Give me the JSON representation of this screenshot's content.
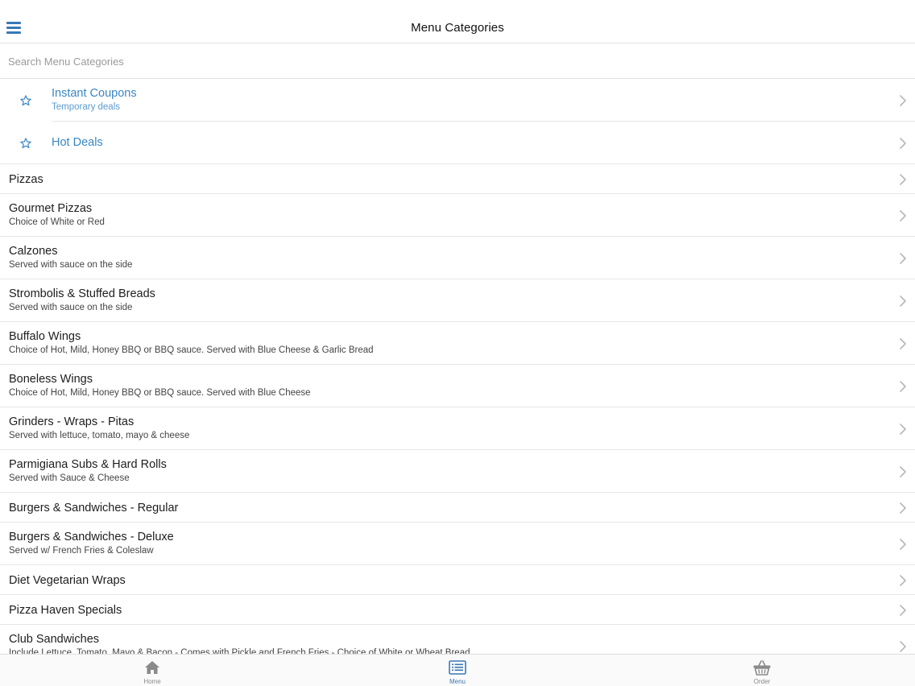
{
  "header": {
    "title": "Menu Categories",
    "menu_icon": "hamburger-icon"
  },
  "search": {
    "placeholder": "Search Menu Categories",
    "value": ""
  },
  "favorites": [
    {
      "title": "Instant Coupons",
      "subtitle": "Temporary deals",
      "icon": "star-outline-icon"
    },
    {
      "title": "Hot Deals",
      "subtitle": "",
      "icon": "star-outline-icon"
    }
  ],
  "categories": [
    {
      "title": "Pizzas",
      "subtitle": ""
    },
    {
      "title": "Gourmet Pizzas",
      "subtitle": "Choice of White or Red"
    },
    {
      "title": "Calzones",
      "subtitle": "Served with sauce on the side"
    },
    {
      "title": "Strombolis & Stuffed Breads",
      "subtitle": "Served with sauce on the side"
    },
    {
      "title": "Buffalo Wings",
      "subtitle": "Choice of Hot, Mild, Honey BBQ or BBQ sauce. Served with Blue Cheese & Garlic Bread"
    },
    {
      "title": "Boneless Wings",
      "subtitle": "Choice of Hot, Mild, Honey BBQ or BBQ sauce. Served with Blue Cheese"
    },
    {
      "title": "Grinders - Wraps - Pitas",
      "subtitle": "Served with lettuce, tomato, mayo & cheese"
    },
    {
      "title": "Parmigiana Subs & Hard Rolls",
      "subtitle": "Served with Sauce & Cheese"
    },
    {
      "title": "Burgers & Sandwiches - Regular",
      "subtitle": ""
    },
    {
      "title": "Burgers & Sandwiches - Deluxe",
      "subtitle": "Served w/ French Fries & Coleslaw"
    },
    {
      "title": "Diet Vegetarian Wraps",
      "subtitle": ""
    },
    {
      "title": "Pizza Haven Specials",
      "subtitle": ""
    },
    {
      "title": "Club Sandwiches",
      "subtitle": "Include Lettuce, Tomato, Mayo & Bacon - Comes with Pickle and French Fries - Choice of White or Wheat Bread"
    }
  ],
  "tabs": [
    {
      "label": "Home",
      "icon": "home-icon",
      "active": false
    },
    {
      "label": "Menu",
      "icon": "menu-list-icon",
      "active": true
    },
    {
      "label": "Order",
      "icon": "basket-icon",
      "active": false
    }
  ],
  "colors": {
    "accent": "#3a78b5",
    "favorite_text": "#3a86c3",
    "divider": "#e6e6e6"
  }
}
